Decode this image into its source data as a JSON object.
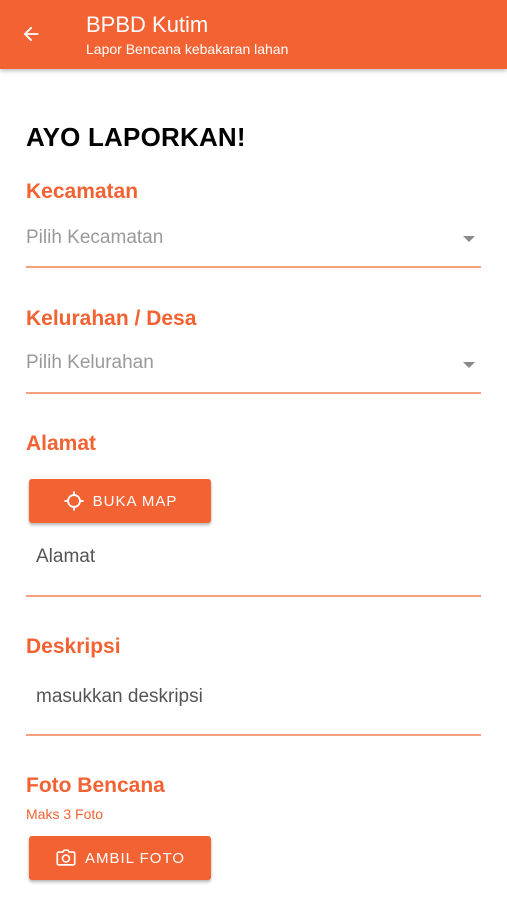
{
  "appbar": {
    "title": "BPBD Kutim",
    "subtitle": "Lapor Bencana kebakaran lahan",
    "back_icon": "arrow-left-icon"
  },
  "heading": "AYO LAPORKAN!",
  "form": {
    "kecamatan": {
      "label": "Kecamatan",
      "placeholder": "Pilih Kecamatan"
    },
    "kelurahan": {
      "label": "Kelurahan / Desa",
      "placeholder": "Pilih Kelurahan"
    },
    "alamat": {
      "label": "Alamat",
      "map_button": "BUKA MAP",
      "map_icon": "crosshair-icon",
      "placeholder": "Alamat"
    },
    "deskripsi": {
      "label": "Deskripsi",
      "placeholder": "masukkan deskripsi"
    },
    "foto": {
      "label": "Foto Bencana",
      "hint": "Maks 3 Foto",
      "camera_button": "AMBIL FOTO",
      "camera_icon": "camera-icon"
    }
  },
  "colors": {
    "accent": "#F26232",
    "underline": "#F6A07E",
    "placeholder": "#9a9a9a"
  }
}
